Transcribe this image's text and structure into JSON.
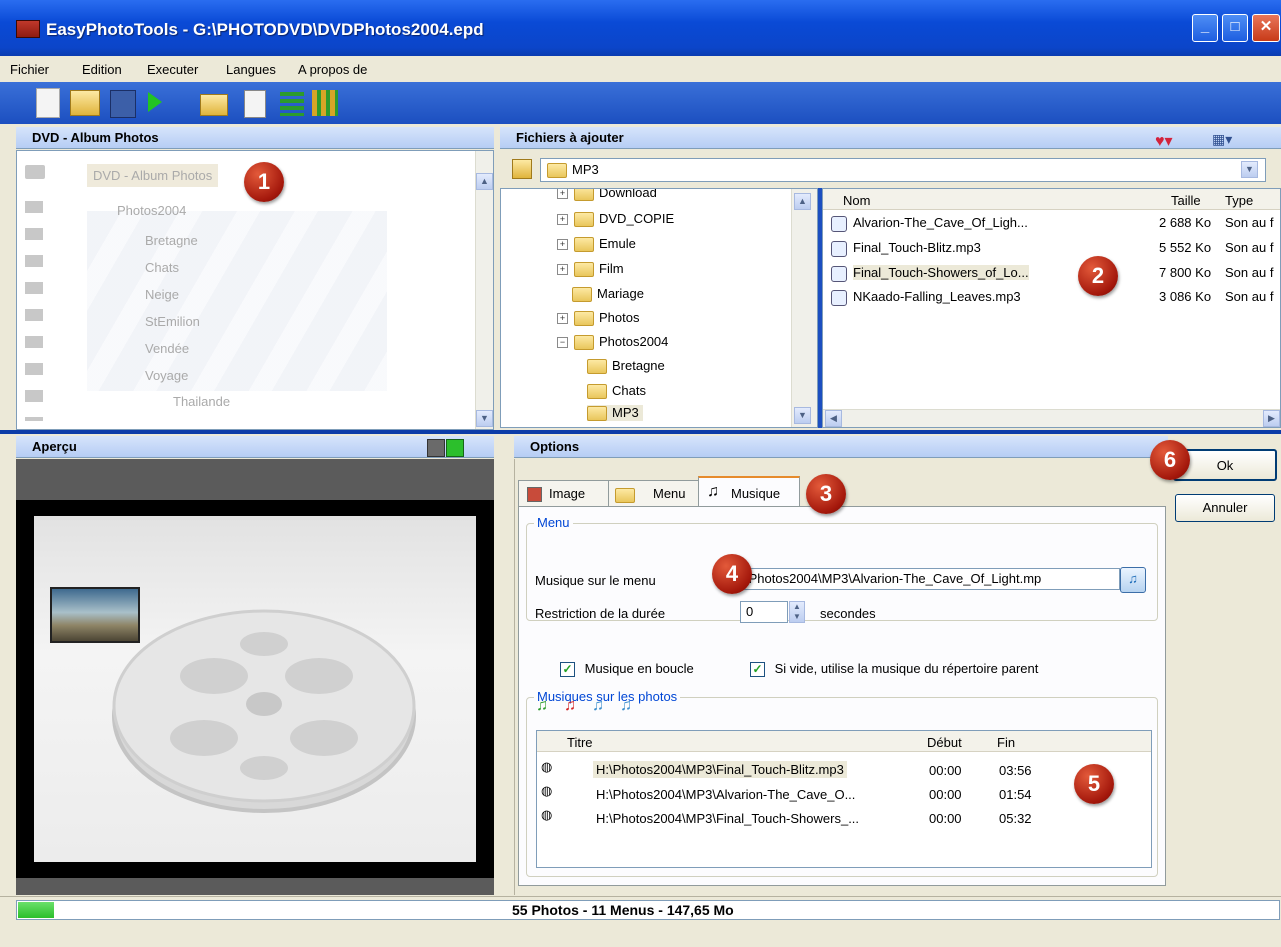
{
  "window": {
    "title": "EasyPhotoTools - G:\\PHOTODVD\\DVDPhotos2004.epd"
  },
  "menu": [
    "Fichier",
    "Edition",
    "Executer",
    "Langues",
    "A propos de"
  ],
  "left_panel": {
    "header": "DVD - Album Photos",
    "tree": [
      "DVD - Album Photos",
      "Photos2004",
      "Bretagne",
      "Chats",
      "Neige",
      "StEmilion",
      "Vendée",
      "Voyage",
      "Thailande"
    ]
  },
  "files_panel": {
    "header": "Fichiers à ajouter",
    "path": "MP3",
    "folders": [
      "Download",
      "DVD_COPIE",
      "Emule",
      "Film",
      "Mariage",
      "Photos",
      "Photos2004",
      "Bretagne",
      "Chats",
      "MP3"
    ],
    "columns": {
      "name": "Nom",
      "size": "Taille",
      "type": "Type"
    },
    "files": [
      {
        "name": "Alvarion-The_Cave_Of_Ligh...",
        "size": "2 688 Ko",
        "type": "Son au f"
      },
      {
        "name": "Final_Touch-Blitz.mp3",
        "size": "5 552 Ko",
        "type": "Son au f"
      },
      {
        "name": "Final_Touch-Showers_of_Lo...",
        "size": "7 800 Ko",
        "type": "Son au f"
      },
      {
        "name": "NKaado-Falling_Leaves.mp3",
        "size": "3 086 Ko",
        "type": "Son au f"
      }
    ]
  },
  "preview": {
    "header": "Aperçu"
  },
  "options": {
    "header": "Options",
    "tabs": [
      "Image",
      "Menu",
      "Musique"
    ],
    "menu_group": {
      "label": "Menu",
      "music_label": "Musique sur le menu",
      "music_value": "\\Photos2004\\MP3\\Alvarion-The_Cave_Of_Light.mp",
      "restriction_label": "Restriction de la durée",
      "restriction_value": "0",
      "seconds": "secondes"
    },
    "photos_group": {
      "label": "Musiques sur les photos",
      "loop": "Musique en boucle",
      "parent": "Si vide, utilise la musique du répertoire parent"
    },
    "list": {
      "columns": {
        "title": "Titre",
        "start": "Début",
        "end": "Fin"
      },
      "rows": [
        {
          "title": "H:\\Photos2004\\MP3\\Final_Touch-Blitz.mp3",
          "start": "00:00",
          "end": "03:56"
        },
        {
          "title": "H:\\Photos2004\\MP3\\Alvarion-The_Cave_O...",
          "start": "00:00",
          "end": "01:54"
        },
        {
          "title": "H:\\Photos2004\\MP3\\Final_Touch-Showers_...",
          "start": "00:00",
          "end": "05:32"
        }
      ]
    }
  },
  "buttons": {
    "ok": "Ok",
    "cancel": "Annuler"
  },
  "status": {
    "text": "55 Photos - 11 Menus - 147,65 Mo"
  },
  "badges": [
    "1",
    "2",
    "3",
    "4",
    "5",
    "6"
  ],
  "colors": {
    "titlebar": "#0a4ad6",
    "badge": "#a3170b",
    "progress": "#2bbf2b"
  }
}
